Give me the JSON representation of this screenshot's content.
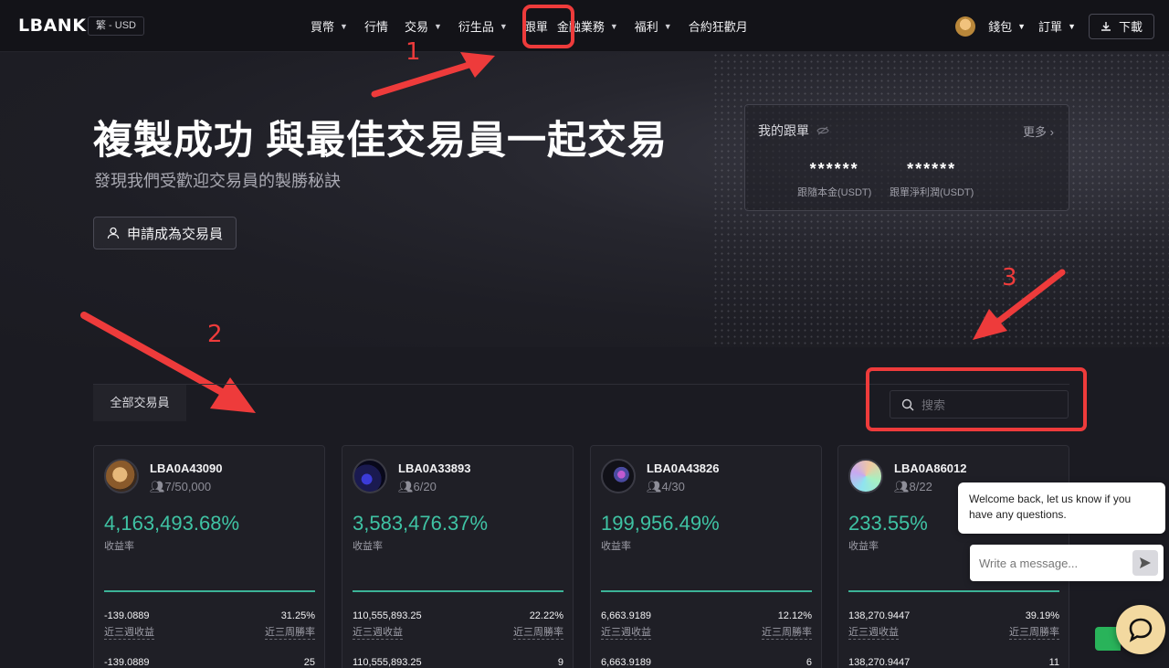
{
  "nav": {
    "logo": "LBANK",
    "locale": "繁 - USD",
    "menu": [
      {
        "label": "買幣",
        "chevron": true
      },
      {
        "label": "行情",
        "chevron": false
      },
      {
        "label": "交易",
        "chevron": true
      },
      {
        "label": "衍生品",
        "chevron": true
      },
      {
        "label": "跟單",
        "chevron": false
      },
      {
        "label": "金融業務",
        "chevron": true
      },
      {
        "label": "福利",
        "chevron": true
      },
      {
        "label": "合約狂歡月",
        "chevron": false
      }
    ],
    "wallet": "錢包",
    "orders": "訂單",
    "download": "下載"
  },
  "hero": {
    "title": "複製成功 與最佳交易員一起交易",
    "subtitle": "發現我們受歡迎交易員的製勝秘訣",
    "apply_button": "申請成為交易員"
  },
  "my_copy": {
    "title": "我的跟單",
    "more": "更多",
    "stats": [
      {
        "value": "******",
        "label": "跟隨本金(USDT)"
      },
      {
        "value": "******",
        "label": "跟單淨利潤(USDT)"
      }
    ]
  },
  "annotations": [
    "1",
    "2",
    "3"
  ],
  "tabs": {
    "all": "全部交易員"
  },
  "search": {
    "placeholder": "搜索"
  },
  "traders": [
    {
      "name": "LBA0A43090",
      "followers": "7/50,000",
      "roi": "4,163,493.68%",
      "roi_label": "收益率",
      "profit": "-139.0889",
      "profit_label": "近三週收益",
      "winrate": "31.25%",
      "winrate_label": "近三周勝率",
      "profit2": "-139.0889",
      "trades": "25"
    },
    {
      "name": "LBA0A33893",
      "followers": "6/20",
      "roi": "3,583,476.37%",
      "roi_label": "收益率",
      "profit": "110,555,893.25",
      "profit_label": "近三週收益",
      "winrate": "22.22%",
      "winrate_label": "近三周勝率",
      "profit2": "110,555,893.25",
      "trades": "9"
    },
    {
      "name": "LBA0A43826",
      "followers": "4/30",
      "roi": "199,956.49%",
      "roi_label": "收益率",
      "profit": "6,663.9189",
      "profit_label": "近三週收益",
      "winrate": "12.12%",
      "winrate_label": "近三周勝率",
      "profit2": "6,663.9189",
      "trades": "6"
    },
    {
      "name": "LBA0A86012",
      "followers": "8/22",
      "roi": "233.55%",
      "roi_label": "收益率",
      "profit": "138,270.9447",
      "profit_label": "近三週收益",
      "winrate": "39.19%",
      "winrate_label": "近三周勝率",
      "profit2": "138,270.9447",
      "trades": "11"
    }
  ],
  "chat": {
    "welcome": "Welcome back, let us know if you have any questions.",
    "placeholder": "Write a message..."
  },
  "colors": {
    "accent_green": "#3fc3a4",
    "annotation_red": "#ee3b3b"
  }
}
